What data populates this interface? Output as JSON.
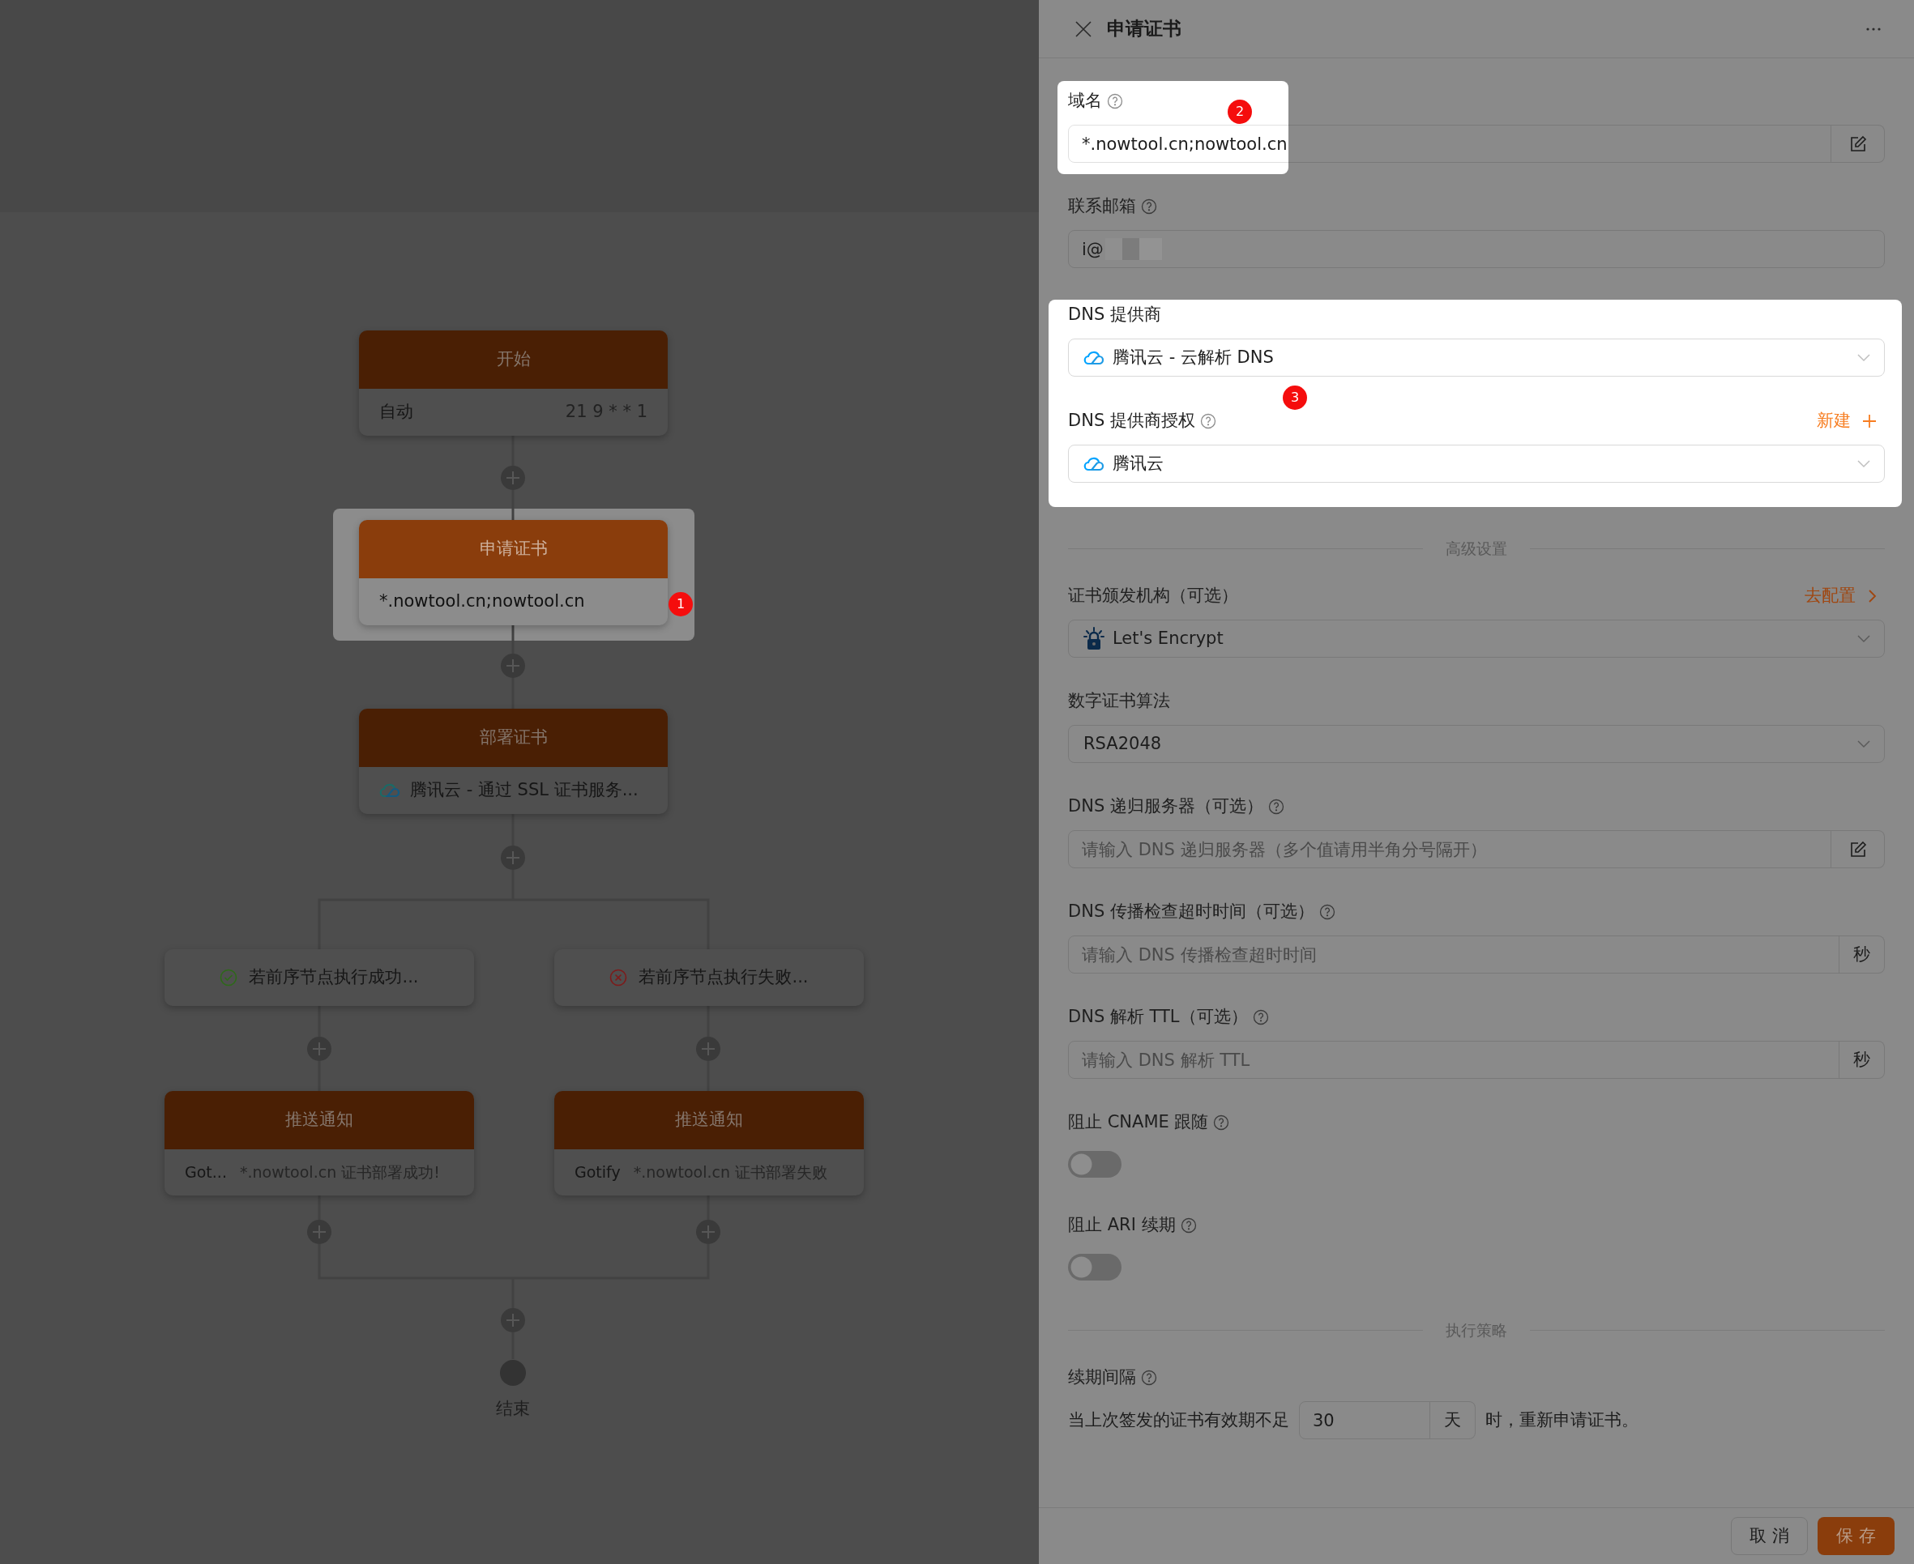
{
  "canvas": {
    "nodes": [
      {
        "kind": "start",
        "title": "开始",
        "text": "自动",
        "detail": "21 9 * * 1",
        "highlighted": false
      },
      {
        "kind": "apply",
        "title": "申请证书",
        "text": "*.nowtool.cn;nowtool.cn",
        "highlighted": true,
        "marker": "1"
      },
      {
        "kind": "deploy",
        "title": "部署证书",
        "text": "腾讯云 - 通过 SSL 证书服务...",
        "highlighted": false
      }
    ],
    "branches": [
      {
        "condition": {
          "kind": "success",
          "label": "若前序节点执行成功..."
        },
        "notify": {
          "title": "推送通知",
          "channel": "Got...",
          "message": "*.nowtool.cn 证书部署成功!"
        }
      },
      {
        "condition": {
          "kind": "failure",
          "label": "若前序节点执行失败..."
        },
        "notify": {
          "title": "推送通知",
          "channel": "Gotify",
          "message": "*.nowtool.cn 证书部署失败"
        }
      }
    ],
    "end_label": "结束"
  },
  "drawer": {
    "title": "申请证书",
    "fields": [
      {
        "kind": "input",
        "label": "域名",
        "help": true,
        "value": "*.nowtool.cn;nowtool.cn",
        "spotlight": true,
        "marker": "2"
      },
      {
        "kind": "input",
        "label": "联系邮箱",
        "help": true,
        "value": "i@",
        "redacted": true
      },
      {
        "kind": "group",
        "spotlight": true,
        "marker": "3",
        "fields": [
          {
            "kind": "select",
            "label": "DNS 提供商",
            "value": "腾讯云 - 云解析 DNS"
          },
          {
            "kind": "select",
            "label": "DNS 提供商授权",
            "help": true,
            "action": {
              "label": "新建"
            },
            "value": "腾讯云"
          }
        ]
      },
      {
        "kind": "divider",
        "label": "高级设置"
      },
      {
        "kind": "select",
        "label": "证书颁发机构（可选）",
        "action": {
          "label": "去配置"
        },
        "value": "Let's Encrypt"
      },
      {
        "kind": "select",
        "label": "数字证书算法",
        "value": "RSA2048"
      },
      {
        "kind": "input",
        "label": "DNS 递归服务器（可选）",
        "help": true,
        "placeholder": "请输入 DNS 递归服务器（多个值请用半角分号隔开）"
      },
      {
        "kind": "input",
        "label": "DNS 传播检查超时时间（可选）",
        "help": true,
        "placeholder": "请输入 DNS 传播检查超时时间",
        "unit": "秒"
      },
      {
        "kind": "input",
        "label": "DNS 解析 TTL（可选）",
        "help": true,
        "placeholder": "请输入 DNS 解析 TTL",
        "unit": "秒"
      },
      {
        "kind": "switch",
        "label": "阻止 CNAME 跟随",
        "help": true,
        "on": false
      },
      {
        "kind": "switch",
        "label": "阻止 ARI 续期",
        "help": true,
        "on": false
      },
      {
        "kind": "divider",
        "label": "执行策略"
      },
      {
        "kind": "interval",
        "label": "续期间隔",
        "help": true,
        "prefix": "当上次签发的证书有效期不足",
        "value": "30",
        "unit": "天",
        "suffix": "时，重新申请证书。"
      }
    ],
    "buttons": {
      "cancel": "取 消",
      "save": "保 存"
    }
  }
}
